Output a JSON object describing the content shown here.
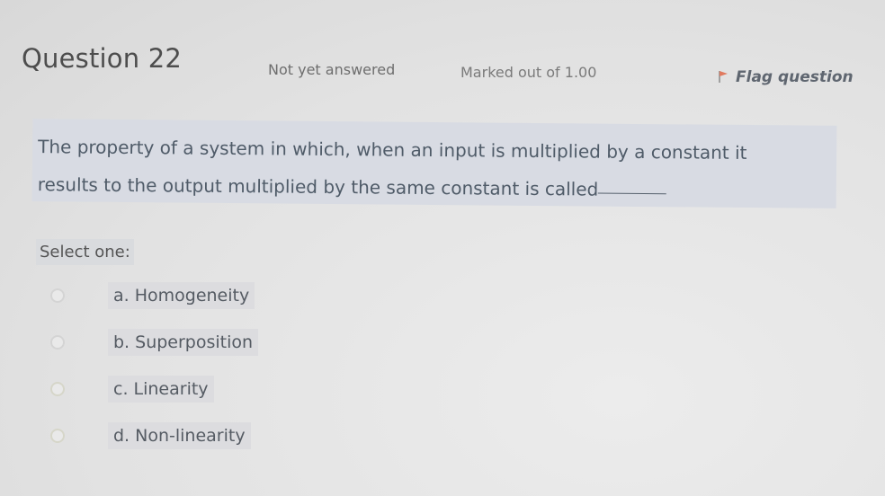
{
  "question": {
    "title": "Question 22",
    "status": "Not yet answered",
    "marks": "Marked out of 1.00",
    "flag_label": "Flag question",
    "flag_icon": "flag-icon",
    "text_line1": "The property of a system in which, when an input is multiplied by a constant it",
    "text_line2": "results to the output multiplied by the same constant is called",
    "select_label": "Select one:",
    "options": [
      {
        "label": "a. Homogeneity",
        "selected": false
      },
      {
        "label": "b. Superposition",
        "selected": false
      },
      {
        "label": "c. Linearity",
        "selected": false
      },
      {
        "label": "d. Non-linearity",
        "selected": false
      }
    ]
  },
  "colors": {
    "question_box": "#d8dbe3",
    "text": "#4f5b68",
    "flag_icon": "#e07a5f"
  }
}
